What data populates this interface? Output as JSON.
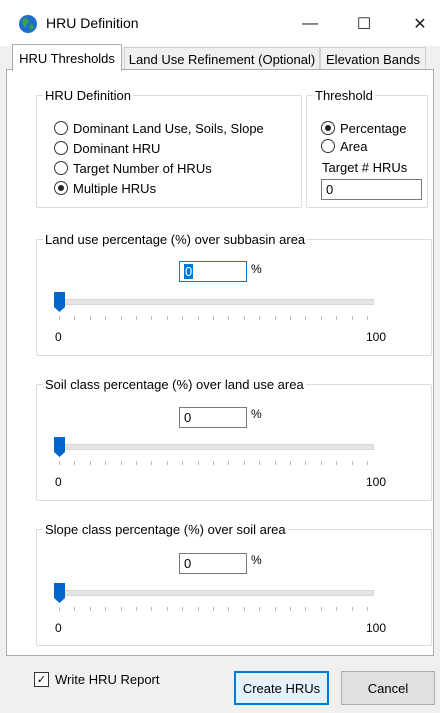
{
  "window": {
    "title": "HRU Definition",
    "minimize_glyph": "—",
    "maximize_glyph": "☐",
    "close_glyph": "✕"
  },
  "tabs": [
    {
      "label": "HRU Thresholds"
    },
    {
      "label": "Land Use Refinement (Optional)"
    },
    {
      "label": "Elevation Bands"
    }
  ],
  "hru_definition": {
    "legend": "HRU Definition",
    "options": [
      {
        "label": "Dominant Land Use, Soils, Slope",
        "selected": false
      },
      {
        "label": "Dominant HRU",
        "selected": false
      },
      {
        "label": "Target Number of HRUs",
        "selected": false
      },
      {
        "label": "Multiple HRUs",
        "selected": true
      }
    ]
  },
  "threshold": {
    "legend": "Threshold",
    "options": [
      {
        "label": "Percentage",
        "selected": true
      },
      {
        "label": "Area",
        "selected": false
      }
    ],
    "target_label": "Target # HRUs",
    "target_value": "0"
  },
  "sliders": [
    {
      "legend": "Land use percentage (%) over subbasin area",
      "value": "0",
      "unit": "%",
      "min_label": "0",
      "max_label": "100",
      "level": 0
    },
    {
      "legend": "Soil class percentage (%) over land use area",
      "value": "0",
      "unit": "%",
      "min_label": "0",
      "max_label": "100",
      "level": 0
    },
    {
      "legend": "Slope class percentage (%) over soil area",
      "value": "0",
      "unit": "%",
      "min_label": "0",
      "max_label": "100",
      "level": 0
    }
  ],
  "footer": {
    "write_report_label": "Write HRU Report",
    "write_report_checked": true,
    "create_label": "Create HRUs",
    "cancel_label": "Cancel"
  },
  "colors": {
    "accent": "#0078d7",
    "slider_thumb": "#0066cc"
  },
  "icons": {
    "app": "globe-icon"
  }
}
